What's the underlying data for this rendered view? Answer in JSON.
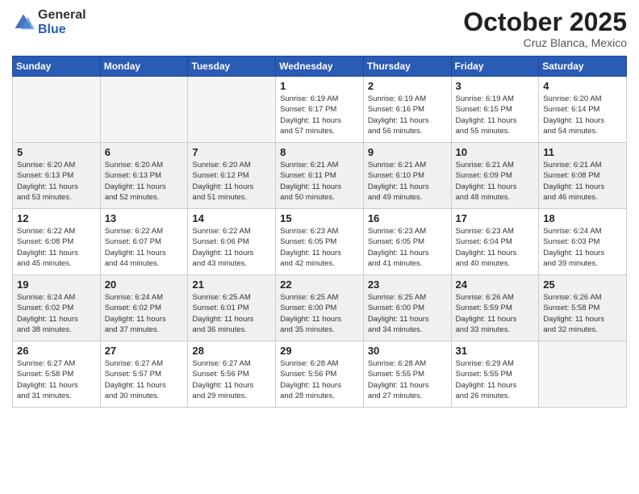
{
  "logo": {
    "general": "General",
    "blue": "Blue"
  },
  "header": {
    "month": "October 2025",
    "location": "Cruz Blanca, Mexico"
  },
  "weekdays": [
    "Sunday",
    "Monday",
    "Tuesday",
    "Wednesday",
    "Thursday",
    "Friday",
    "Saturday"
  ],
  "weeks": [
    [
      {
        "day": "",
        "info": ""
      },
      {
        "day": "",
        "info": ""
      },
      {
        "day": "",
        "info": ""
      },
      {
        "day": "1",
        "info": "Sunrise: 6:19 AM\nSunset: 6:17 PM\nDaylight: 11 hours\nand 57 minutes."
      },
      {
        "day": "2",
        "info": "Sunrise: 6:19 AM\nSunset: 6:16 PM\nDaylight: 11 hours\nand 56 minutes."
      },
      {
        "day": "3",
        "info": "Sunrise: 6:19 AM\nSunset: 6:15 PM\nDaylight: 11 hours\nand 55 minutes."
      },
      {
        "day": "4",
        "info": "Sunrise: 6:20 AM\nSunset: 6:14 PM\nDaylight: 11 hours\nand 54 minutes."
      }
    ],
    [
      {
        "day": "5",
        "info": "Sunrise: 6:20 AM\nSunset: 6:13 PM\nDaylight: 11 hours\nand 53 minutes."
      },
      {
        "day": "6",
        "info": "Sunrise: 6:20 AM\nSunset: 6:13 PM\nDaylight: 11 hours\nand 52 minutes."
      },
      {
        "day": "7",
        "info": "Sunrise: 6:20 AM\nSunset: 6:12 PM\nDaylight: 11 hours\nand 51 minutes."
      },
      {
        "day": "8",
        "info": "Sunrise: 6:21 AM\nSunset: 6:11 PM\nDaylight: 11 hours\nand 50 minutes."
      },
      {
        "day": "9",
        "info": "Sunrise: 6:21 AM\nSunset: 6:10 PM\nDaylight: 11 hours\nand 49 minutes."
      },
      {
        "day": "10",
        "info": "Sunrise: 6:21 AM\nSunset: 6:09 PM\nDaylight: 11 hours\nand 48 minutes."
      },
      {
        "day": "11",
        "info": "Sunrise: 6:21 AM\nSunset: 6:08 PM\nDaylight: 11 hours\nand 46 minutes."
      }
    ],
    [
      {
        "day": "12",
        "info": "Sunrise: 6:22 AM\nSunset: 6:08 PM\nDaylight: 11 hours\nand 45 minutes."
      },
      {
        "day": "13",
        "info": "Sunrise: 6:22 AM\nSunset: 6:07 PM\nDaylight: 11 hours\nand 44 minutes."
      },
      {
        "day": "14",
        "info": "Sunrise: 6:22 AM\nSunset: 6:06 PM\nDaylight: 11 hours\nand 43 minutes."
      },
      {
        "day": "15",
        "info": "Sunrise: 6:23 AM\nSunset: 6:05 PM\nDaylight: 11 hours\nand 42 minutes."
      },
      {
        "day": "16",
        "info": "Sunrise: 6:23 AM\nSunset: 6:05 PM\nDaylight: 11 hours\nand 41 minutes."
      },
      {
        "day": "17",
        "info": "Sunrise: 6:23 AM\nSunset: 6:04 PM\nDaylight: 11 hours\nand 40 minutes."
      },
      {
        "day": "18",
        "info": "Sunrise: 6:24 AM\nSunset: 6:03 PM\nDaylight: 11 hours\nand 39 minutes."
      }
    ],
    [
      {
        "day": "19",
        "info": "Sunrise: 6:24 AM\nSunset: 6:02 PM\nDaylight: 11 hours\nand 38 minutes."
      },
      {
        "day": "20",
        "info": "Sunrise: 6:24 AM\nSunset: 6:02 PM\nDaylight: 11 hours\nand 37 minutes."
      },
      {
        "day": "21",
        "info": "Sunrise: 6:25 AM\nSunset: 6:01 PM\nDaylight: 11 hours\nand 36 minutes."
      },
      {
        "day": "22",
        "info": "Sunrise: 6:25 AM\nSunset: 6:00 PM\nDaylight: 11 hours\nand 35 minutes."
      },
      {
        "day": "23",
        "info": "Sunrise: 6:25 AM\nSunset: 6:00 PM\nDaylight: 11 hours\nand 34 minutes."
      },
      {
        "day": "24",
        "info": "Sunrise: 6:26 AM\nSunset: 5:59 PM\nDaylight: 11 hours\nand 33 minutes."
      },
      {
        "day": "25",
        "info": "Sunrise: 6:26 AM\nSunset: 5:58 PM\nDaylight: 11 hours\nand 32 minutes."
      }
    ],
    [
      {
        "day": "26",
        "info": "Sunrise: 6:27 AM\nSunset: 5:58 PM\nDaylight: 11 hours\nand 31 minutes."
      },
      {
        "day": "27",
        "info": "Sunrise: 6:27 AM\nSunset: 5:57 PM\nDaylight: 11 hours\nand 30 minutes."
      },
      {
        "day": "28",
        "info": "Sunrise: 6:27 AM\nSunset: 5:56 PM\nDaylight: 11 hours\nand 29 minutes."
      },
      {
        "day": "29",
        "info": "Sunrise: 6:28 AM\nSunset: 5:56 PM\nDaylight: 11 hours\nand 28 minutes."
      },
      {
        "day": "30",
        "info": "Sunrise: 6:28 AM\nSunset: 5:55 PM\nDaylight: 11 hours\nand 27 minutes."
      },
      {
        "day": "31",
        "info": "Sunrise: 6:29 AM\nSunset: 5:55 PM\nDaylight: 11 hours\nand 26 minutes."
      },
      {
        "day": "",
        "info": ""
      }
    ]
  ]
}
